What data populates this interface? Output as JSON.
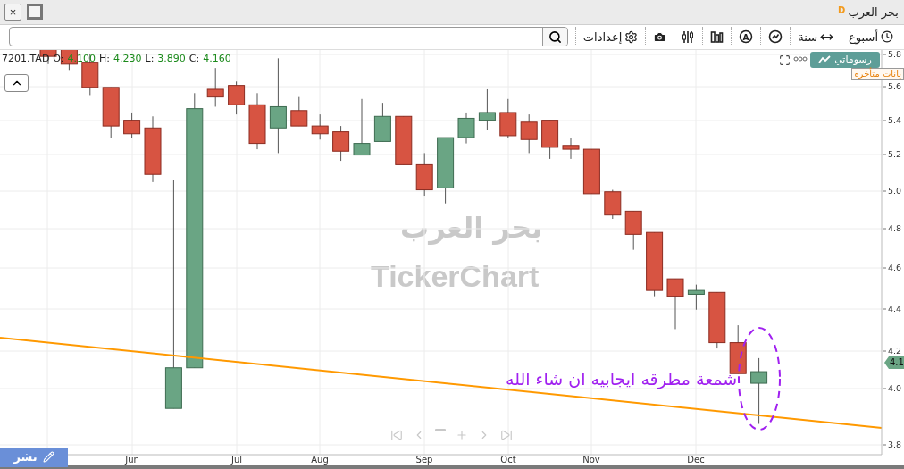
{
  "window": {
    "title": "بحر العرب",
    "badge": "D",
    "controls": [
      {
        "kind": "close",
        "label": "×"
      },
      {
        "kind": "maximize"
      }
    ]
  },
  "toolbar": {
    "items": [
      {
        "kind": "week",
        "label": "أسبوع"
      },
      {
        "kind": "year",
        "label": "سنة"
      },
      {
        "kind": "trend"
      },
      {
        "kind": "letter",
        "glyph": "A"
      },
      {
        "kind": "bars"
      },
      {
        "kind": "indicators"
      },
      {
        "kind": "camera"
      },
      {
        "kind": "settings",
        "label": "إعدادات"
      }
    ]
  },
  "chart": {
    "symbol": "7201.TAD",
    "ohlc": [
      {
        "label": "O:",
        "value": "4.100"
      },
      {
        "label": "H:",
        "value": "4.230"
      },
      {
        "label": "L:",
        "value": "3.890"
      },
      {
        "label": "C:",
        "value": "4.160"
      }
    ],
    "my_drawings": "رسوماتي",
    "delayed_notice": "يانات متأخره",
    "price_tag": "4.1",
    "watermark": {
      "name": "بحر العرب",
      "brand": "TickerChart"
    },
    "annotation": "شمعة مطرقه ايجابيه ان شاء الله",
    "navigation": [
      {
        "kind": "first"
      },
      {
        "kind": "prev"
      },
      {
        "kind": "zoom-out"
      },
      {
        "kind": "zoom-in"
      },
      {
        "kind": "next"
      },
      {
        "kind": "last"
      }
    ],
    "publish": "نشر",
    "price_axis": [
      "5.8",
      "5.6",
      "5.4",
      "5.2",
      "5.0",
      "4.8",
      "4.6",
      "4.4",
      "4.2",
      "4.0",
      "3.8"
    ],
    "date_axis": [
      "Jun",
      "Jul",
      "Aug",
      "Sep",
      "Oct",
      "Nov",
      "Dec"
    ]
  }
}
